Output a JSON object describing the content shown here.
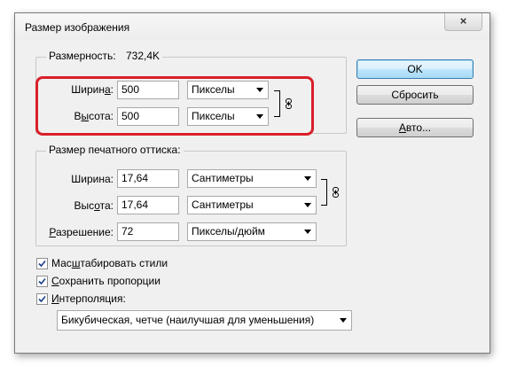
{
  "window": {
    "title": "Размер изображения",
    "close_label": "×"
  },
  "pixel_dimensions": {
    "label": "Размерность:",
    "size": "732,4K",
    "width_label_pre": "Ширин",
    "width_label_u": "а",
    "width_label_post": ":",
    "width_value": "500",
    "width_unit": "Пикселы",
    "height_label_pre": "В",
    "height_label_u": "ы",
    "height_label_post": "сота:",
    "height_value": "500",
    "height_unit": "Пикселы"
  },
  "document_size": {
    "label": "Размер печатного оттиска:",
    "width_label": "Ширина:",
    "width_value": "17,64",
    "width_unit": "Сантиметры",
    "height_label_pre": "Выс",
    "height_label_u": "о",
    "height_label_post": "та:",
    "height_value": "17,64",
    "height_unit": "Сантиметры",
    "resolution_label_u": "Р",
    "resolution_label_post": "азрешение:",
    "resolution_value": "72",
    "resolution_unit": "Пикселы/дюйм"
  },
  "options": {
    "scale_styles_pre": "Мас",
    "scale_styles_u": "ш",
    "scale_styles_post": "табировать стили",
    "scale_styles_checked": true,
    "constrain_u": "С",
    "constrain_post": "охранить пропорции",
    "constrain_checked": true,
    "resample_u": "И",
    "resample_post": "нтерполяция:",
    "resample_checked": true,
    "resample_method": "Бикубическая, четче (наилучшая для уменьшения)"
  },
  "buttons": {
    "ok": "OK",
    "reset": "Сбросить",
    "auto_pre": "",
    "auto_u": "А",
    "auto_post": "вто..."
  },
  "colors": {
    "highlight": "#d9202a",
    "default_button_border": "#3c7fb1"
  }
}
